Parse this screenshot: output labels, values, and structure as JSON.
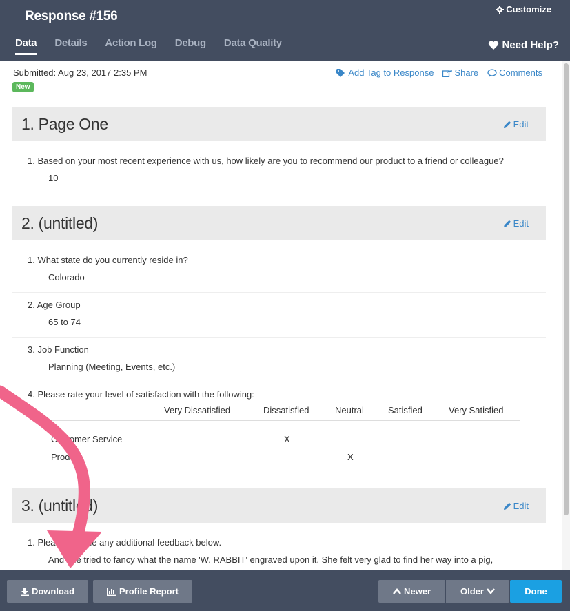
{
  "header": {
    "title": "Response #156",
    "customize_label": "Customize",
    "help_label": "Need Help?",
    "tabs": [
      {
        "label": "Data",
        "active": true
      },
      {
        "label": "Details"
      },
      {
        "label": "Action Log"
      },
      {
        "label": "Debug"
      },
      {
        "label": "Data Quality"
      }
    ]
  },
  "meta": {
    "submitted": "Submitted: Aug 23, 2017 2:35 PM",
    "badge": "New",
    "add_tag_label": "Add Tag to Response",
    "share_label": "Share",
    "comments_label": "Comments"
  },
  "edit_label": "Edit",
  "sections": [
    {
      "title": "1. Page One",
      "questions": [
        {
          "q": "1. Based on your most recent experience with us, how likely are you to recommend our product to a friend or colleague?",
          "a": "10"
        }
      ]
    },
    {
      "title": "2. (untitled)",
      "questions": [
        {
          "q": "1. What state do you currently reside in?",
          "a": "Colorado"
        },
        {
          "q": "2. Age Group",
          "a": "65 to 74"
        },
        {
          "q": "3. Job Function",
          "a": "Planning (Meeting, Events, etc.)"
        },
        {
          "q": "4. Please rate your level of satisfaction with the following:"
        }
      ],
      "matrix": {
        "columns": [
          "Very Dissatisfied",
          "Dissatisfied",
          "Neutral",
          "Satisfied",
          "Very Satisfied"
        ],
        "rows": [
          {
            "label": "Customer Service",
            "selected": "Dissatisfied",
            "mark": "X"
          },
          {
            "label": "Product",
            "selected": "Neutral",
            "mark": "X"
          }
        ]
      }
    },
    {
      "title": "3. (untitled)",
      "questions": [
        {
          "q": "1. Please provide any additional feedback below.",
          "a": "And she tried to fancy what the name 'W. RABBIT' engraved upon it. She felt very glad to find her way into a pig,"
        }
      ]
    }
  ],
  "footer": {
    "download_label": "Download",
    "profile_label": "Profile Report",
    "newer_label": "Newer",
    "older_label": "Older",
    "done_label": "Done"
  },
  "colors": {
    "header_bg": "#434d60",
    "link": "#3a87c8",
    "badge": "#5cb85c",
    "done": "#1ba0e2",
    "annotation_arrow": "#f0648a"
  }
}
